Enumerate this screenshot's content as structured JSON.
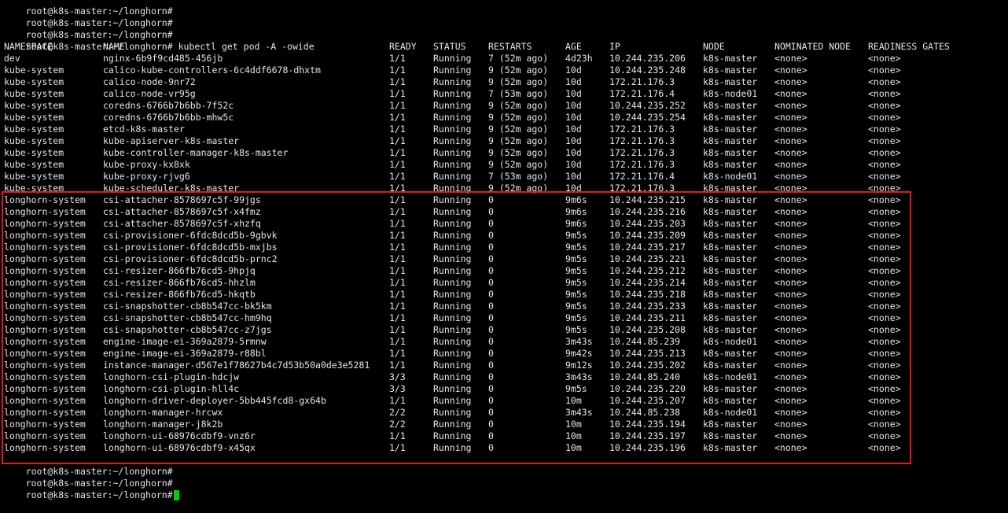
{
  "terminal": {
    "prompt": "root@k8s-master:~/longhorn#",
    "cursor_color": "#00d000",
    "highlight_color": "#e01b1b",
    "history": [
      {
        "prompt": "root@k8s-master:~/longhorn#",
        "command": ""
      },
      {
        "prompt": "root@k8s-master:~/longhorn#",
        "command": ""
      },
      {
        "prompt": "root@k8s-master:~/longhorn#",
        "command": ""
      },
      {
        "prompt": "root@k8s-master:~/longhorn#",
        "command": " kubectl get pod -A -owide"
      }
    ],
    "table": {
      "headers": [
        "NAMESPACE",
        "NAME",
        "READY",
        "STATUS",
        "RESTARTS",
        "AGE",
        "IP",
        "NODE",
        "NOMINATED NODE",
        "READINESS GATES"
      ],
      "rows": [
        [
          "dev",
          "nginx-6b9f9cd485-456jb",
          "1/1",
          "Running",
          "7 (52m ago)",
          "4d23h",
          "10.244.235.206",
          "k8s-master",
          "<none>",
          "<none>"
        ],
        [
          "kube-system",
          "calico-kube-controllers-6c4ddf6678-dhxtm",
          "1/1",
          "Running",
          "9 (52m ago)",
          "10d",
          "10.244.235.248",
          "k8s-master",
          "<none>",
          "<none>"
        ],
        [
          "kube-system",
          "calico-node-9nr72",
          "1/1",
          "Running",
          "9 (52m ago)",
          "10d",
          "172.21.176.3",
          "k8s-master",
          "<none>",
          "<none>"
        ],
        [
          "kube-system",
          "calico-node-vr95g",
          "1/1",
          "Running",
          "7 (53m ago)",
          "10d",
          "172.21.176.4",
          "k8s-node01",
          "<none>",
          "<none>"
        ],
        [
          "kube-system",
          "coredns-6766b7b6bb-7f52c",
          "1/1",
          "Running",
          "9 (52m ago)",
          "10d",
          "10.244.235.252",
          "k8s-master",
          "<none>",
          "<none>"
        ],
        [
          "kube-system",
          "coredns-6766b7b6bb-mhw5c",
          "1/1",
          "Running",
          "9 (52m ago)",
          "10d",
          "10.244.235.254",
          "k8s-master",
          "<none>",
          "<none>"
        ],
        [
          "kube-system",
          "etcd-k8s-master",
          "1/1",
          "Running",
          "9 (52m ago)",
          "10d",
          "172.21.176.3",
          "k8s-master",
          "<none>",
          "<none>"
        ],
        [
          "kube-system",
          "kube-apiserver-k8s-master",
          "1/1",
          "Running",
          "9 (52m ago)",
          "10d",
          "172.21.176.3",
          "k8s-master",
          "<none>",
          "<none>"
        ],
        [
          "kube-system",
          "kube-controller-manager-k8s-master",
          "1/1",
          "Running",
          "9 (52m ago)",
          "10d",
          "172.21.176.3",
          "k8s-master",
          "<none>",
          "<none>"
        ],
        [
          "kube-system",
          "kube-proxy-kx8xk",
          "1/1",
          "Running",
          "9 (52m ago)",
          "10d",
          "172.21.176.3",
          "k8s-master",
          "<none>",
          "<none>"
        ],
        [
          "kube-system",
          "kube-proxy-rjvg6",
          "1/1",
          "Running",
          "7 (53m ago)",
          "10d",
          "172.21.176.4",
          "k8s-node01",
          "<none>",
          "<none>"
        ],
        [
          "kube-system",
          "kube-scheduler-k8s-master",
          "1/1",
          "Running",
          "9 (52m ago)",
          "10d",
          "172.21.176.3",
          "k8s-master",
          "<none>",
          "<none>"
        ],
        [
          "longhorn-system",
          "csi-attacher-8578697c5f-99jgs",
          "1/1",
          "Running",
          "0",
          "9m6s",
          "10.244.235.215",
          "k8s-master",
          "<none>",
          "<none>"
        ],
        [
          "longhorn-system",
          "csi-attacher-8578697c5f-x4fmz",
          "1/1",
          "Running",
          "0",
          "9m6s",
          "10.244.235.216",
          "k8s-master",
          "<none>",
          "<none>"
        ],
        [
          "longhorn-system",
          "csi-attacher-8578697c5f-xhzfq",
          "1/1",
          "Running",
          "0",
          "9m6s",
          "10.244.235.203",
          "k8s-master",
          "<none>",
          "<none>"
        ],
        [
          "longhorn-system",
          "csi-provisioner-6fdc8dcd5b-9gbvk",
          "1/1",
          "Running",
          "0",
          "9m5s",
          "10.244.235.209",
          "k8s-master",
          "<none>",
          "<none>"
        ],
        [
          "longhorn-system",
          "csi-provisioner-6fdc8dcd5b-mxjbs",
          "1/1",
          "Running",
          "0",
          "9m5s",
          "10.244.235.217",
          "k8s-master",
          "<none>",
          "<none>"
        ],
        [
          "longhorn-system",
          "csi-provisioner-6fdc8dcd5b-prnc2",
          "1/1",
          "Running",
          "0",
          "9m5s",
          "10.244.235.221",
          "k8s-master",
          "<none>",
          "<none>"
        ],
        [
          "longhorn-system",
          "csi-resizer-866fb76cd5-9hpjq",
          "1/1",
          "Running",
          "0",
          "9m5s",
          "10.244.235.212",
          "k8s-master",
          "<none>",
          "<none>"
        ],
        [
          "longhorn-system",
          "csi-resizer-866fb76cd5-hhzlm",
          "1/1",
          "Running",
          "0",
          "9m5s",
          "10.244.235.214",
          "k8s-master",
          "<none>",
          "<none>"
        ],
        [
          "longhorn-system",
          "csi-resizer-866fb76cd5-hkqtb",
          "1/1",
          "Running",
          "0",
          "9m5s",
          "10.244.235.218",
          "k8s-master",
          "<none>",
          "<none>"
        ],
        [
          "longhorn-system",
          "csi-snapshotter-cb8b547cc-bk5km",
          "1/1",
          "Running",
          "0",
          "9m5s",
          "10.244.235.233",
          "k8s-master",
          "<none>",
          "<none>"
        ],
        [
          "longhorn-system",
          "csi-snapshotter-cb8b547cc-hm9hq",
          "1/1",
          "Running",
          "0",
          "9m5s",
          "10.244.235.211",
          "k8s-master",
          "<none>",
          "<none>"
        ],
        [
          "longhorn-system",
          "csi-snapshotter-cb8b547cc-z7jgs",
          "1/1",
          "Running",
          "0",
          "9m5s",
          "10.244.235.208",
          "k8s-master",
          "<none>",
          "<none>"
        ],
        [
          "longhorn-system",
          "engine-image-ei-369a2879-5rmnw",
          "1/1",
          "Running",
          "0",
          "3m43s",
          "10.244.85.239",
          "k8s-node01",
          "<none>",
          "<none>"
        ],
        [
          "longhorn-system",
          "engine-image-ei-369a2879-r88bl",
          "1/1",
          "Running",
          "0",
          "9m42s",
          "10.244.235.213",
          "k8s-master",
          "<none>",
          "<none>"
        ],
        [
          "longhorn-system",
          "instance-manager-d567e1f78627b4c7d53b50a0de3e5281",
          "1/1",
          "Running",
          "0",
          "9m12s",
          "10.244.235.202",
          "k8s-master",
          "<none>",
          "<none>"
        ],
        [
          "longhorn-system",
          "longhorn-csi-plugin-hdcjw",
          "3/3",
          "Running",
          "0",
          "3m43s",
          "10.244.85.240",
          "k8s-node01",
          "<none>",
          "<none>"
        ],
        [
          "longhorn-system",
          "longhorn-csi-plugin-hll4c",
          "3/3",
          "Running",
          "0",
          "9m5s",
          "10.244.235.220",
          "k8s-master",
          "<none>",
          "<none>"
        ],
        [
          "longhorn-system",
          "longhorn-driver-deployer-5bb445fcd8-gx64b",
          "1/1",
          "Running",
          "0",
          "10m",
          "10.244.235.207",
          "k8s-master",
          "<none>",
          "<none>"
        ],
        [
          "longhorn-system",
          "longhorn-manager-hrcwx",
          "2/2",
          "Running",
          "0",
          "3m43s",
          "10.244.85.238",
          "k8s-node01",
          "<none>",
          "<none>"
        ],
        [
          "longhorn-system",
          "longhorn-manager-j8k2b",
          "2/2",
          "Running",
          "0",
          "10m",
          "10.244.235.194",
          "k8s-master",
          "<none>",
          "<none>"
        ],
        [
          "longhorn-system",
          "longhorn-ui-68976cdbf9-vnz6r",
          "1/1",
          "Running",
          "0",
          "10m",
          "10.244.235.197",
          "k8s-master",
          "<none>",
          "<none>"
        ],
        [
          "longhorn-system",
          "longhorn-ui-68976cdbf9-x45qx",
          "1/1",
          "Running",
          "0",
          "10m",
          "10.244.235.196",
          "k8s-master",
          "<none>",
          "<none>"
        ]
      ]
    },
    "trailing_prompts": [
      {
        "prompt": "root@k8s-master:~/longhorn#",
        "command": ""
      },
      {
        "prompt": "root@k8s-master:~/longhorn#",
        "command": ""
      },
      {
        "prompt": "root@k8s-master:~/longhorn#",
        "command": ""
      }
    ]
  }
}
